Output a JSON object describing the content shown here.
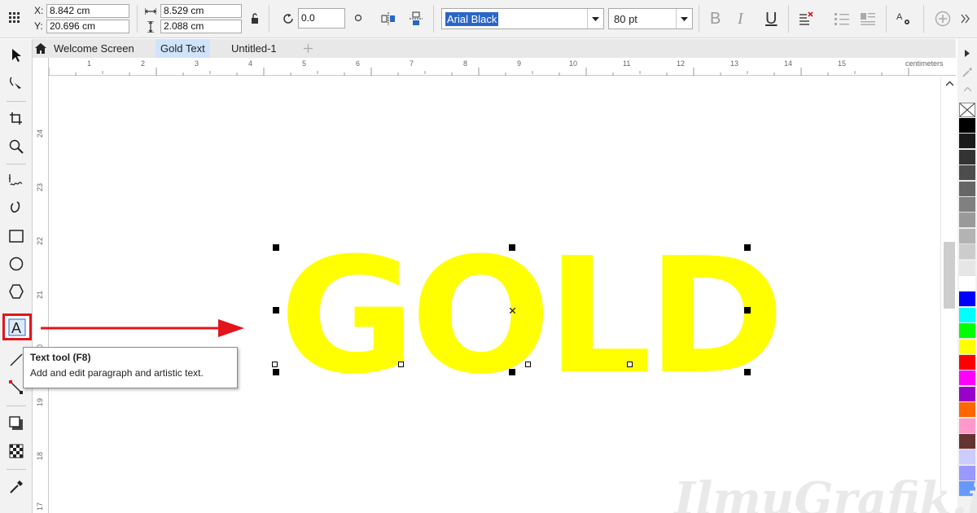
{
  "propbar": {
    "x_label": "X:",
    "x_value": "8.842 cm",
    "y_label": "Y:",
    "y_value": "20.696 cm",
    "width_value": "8.529 cm",
    "height_value": "2.088 cm",
    "rotation_value": "0.0",
    "font_name": "Arial Black",
    "font_size": "80 pt",
    "bold_label": "B",
    "italic_label": "I",
    "underline_label": "U"
  },
  "tabs": [
    {
      "label": "Welcome Screen"
    },
    {
      "label": "Gold Text"
    },
    {
      "label": "Untitled-1"
    }
  ],
  "ruler": {
    "unit_label": "centimeters",
    "h_numbers": [
      "1",
      "2",
      "3",
      "4",
      "5",
      "6",
      "7",
      "8",
      "9",
      "10",
      "11",
      "12",
      "13",
      "14",
      "15"
    ],
    "v_numbers": [
      "24",
      "23",
      "22",
      "21",
      "20",
      "19",
      "18",
      "17"
    ]
  },
  "canvas": {
    "artistic_text": "GOLD",
    "text_color": "#ffff00"
  },
  "tooltip": {
    "title": "Text tool (F8)",
    "description": "Add and edit paragraph and artistic text."
  },
  "palette_colors": [
    "#000000",
    "#1a1a1a",
    "#333333",
    "#4d4d4d",
    "#666666",
    "#808080",
    "#999999",
    "#b3b3b3",
    "#cccccc",
    "#e6e6e6",
    "#ffffff",
    "#0000ff",
    "#00ffff",
    "#00ff00",
    "#ffff00",
    "#ff0000",
    "#ff00ff",
    "#9900cc",
    "#ff6600",
    "#ff99cc",
    "#663333",
    "#ccccff",
    "#9999ff",
    "#6699ff"
  ],
  "watermark": "IlmuGrafik.id",
  "colors": {
    "highlight": "#e3151a",
    "selection": "#2a66c9"
  }
}
